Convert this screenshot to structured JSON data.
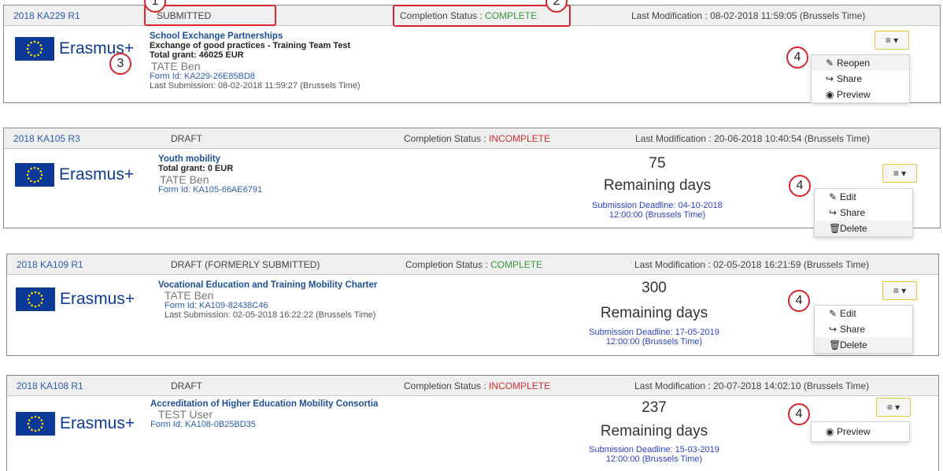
{
  "logo": {
    "text": "Erasmus+"
  },
  "labels": {
    "completion_prefix": "Completion Status : ",
    "last_mod_prefix": "Last Modification : ",
    "remaining": "Remaining days",
    "menu_glyph": "≡ ▾"
  },
  "callouts": [
    "1",
    "2",
    "3",
    "4"
  ],
  "cards": [
    {
      "call_id": "2018 KA229 R1",
      "status": "SUBMITTED",
      "completion": "COMPLETE",
      "last_mod": "08-02-2018 11:59:05 (Brussels Time)",
      "title": "School Exchange Partnerships",
      "subtitle": "Exchange of good practices - Training Team Test",
      "grant": "Total grant: 46025 EUR",
      "person": "TATE Ben",
      "form_id": "Form Id: KA229-26E85BD8",
      "last_submission": "Last Submission: 08-02-2018 11:59:27 (Brussels Time)",
      "menu": [
        "Reopen",
        "Share",
        "Preview"
      ]
    },
    {
      "call_id": "2018 KA105 R3",
      "status": "DRAFT",
      "completion": "INCOMPLETE",
      "last_mod": "20-06-2018 10:40:54 (Brussels Time)",
      "title": "Youth mobility",
      "grant": "Total grant: 0 EUR",
      "person": "TATE Ben",
      "form_id": "Form Id: KA105-66AE6791",
      "remaining_days": "75",
      "deadline_line1": "Submission Deadline: 04-10-2018",
      "deadline_line2": "12:00:00 (Brussels Time)",
      "menu": [
        "Edit",
        "Share",
        "Delete"
      ]
    },
    {
      "call_id": "2018 KA109 R1",
      "status": "DRAFT (FORMERLY SUBMITTED)",
      "completion": "COMPLETE",
      "last_mod": "02-05-2018 16:21:59 (Brussels Time)",
      "title": "Vocational Education and Training Mobility Charter",
      "person": "TATE Ben",
      "form_id": "Form Id: KA109-82438C46",
      "last_submission": "Last Submission: 02-05-2018 16:22:22 (Brussels Time)",
      "remaining_days": "300",
      "deadline_line1": "Submission Deadline: 17-05-2019",
      "deadline_line2": "12:00:00 (Brussels Time)",
      "menu": [
        "Edit",
        "Share",
        "Delete"
      ]
    },
    {
      "call_id": "2018 KA108 R1",
      "status": "DRAFT",
      "completion": "INCOMPLETE",
      "last_mod": "20-07-2018 14:02:10 (Brussels Time)",
      "title": "Accreditation of Higher Education Mobility Consortia",
      "person": "TEST User",
      "form_id": "Form Id: KA108-0B25BD35",
      "remaining_days": "237",
      "deadline_line1": "Submission Deadline: 15-03-2019",
      "deadline_line2": "12:00:00 (Brussels Time)",
      "menu": [
        "Preview"
      ]
    }
  ]
}
